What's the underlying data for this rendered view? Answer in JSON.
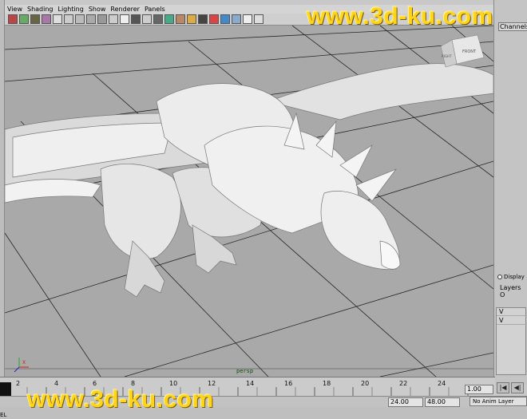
{
  "menubar": {
    "items": [
      "View",
      "Shading",
      "Lighting",
      "Show",
      "Renderer",
      "Panels"
    ]
  },
  "channel_box": {
    "tab_label": "Channels",
    "display_label": "Display",
    "layers_label": "Layers",
    "layers_overflow": "O",
    "layer_rows": [
      "V",
      "V"
    ]
  },
  "viewport": {
    "camera_label": "persp",
    "view_cube_label": "FRONT",
    "view_cube_right": "RIGHT",
    "axis_label": "X"
  },
  "timeline": {
    "ticks": [
      "2",
      "4",
      "6",
      "8",
      "10",
      "12",
      "14",
      "16",
      "18",
      "20",
      "22",
      "24"
    ],
    "current_frame": "1.00"
  },
  "range": {
    "end_value": "24.00",
    "max_value": "48.00",
    "anim_layer": "No Anim Layer"
  },
  "status": {
    "left_label": "EL"
  },
  "watermark": {
    "top": "www.3d-ku.com",
    "bottom": "www.3d-ku.com"
  },
  "colors": {
    "viewport_bg": "#a9a9a9",
    "grid": "#222222",
    "model": "#e9e9e9",
    "watermark": "#ffd41a"
  }
}
